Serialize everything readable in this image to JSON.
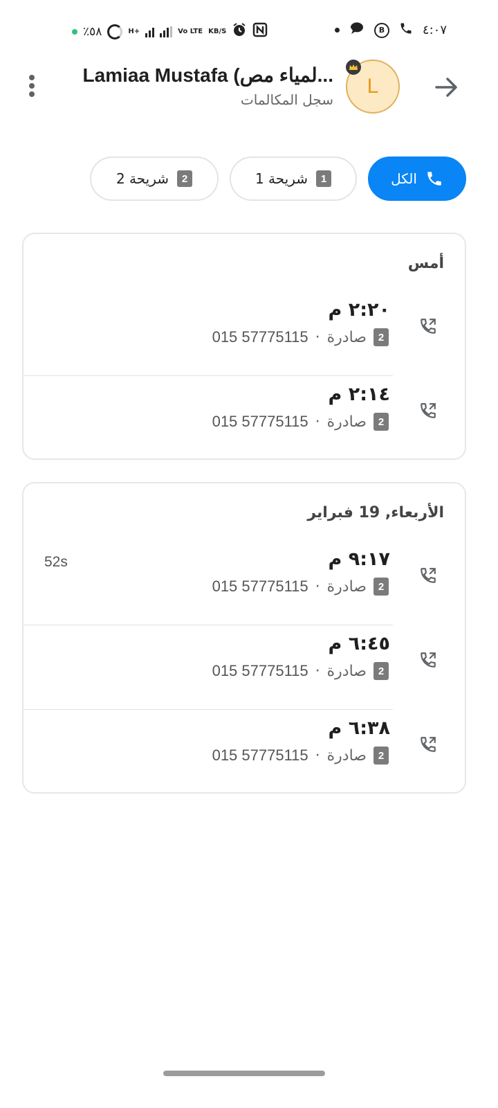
{
  "status_bar": {
    "time": "٤:٠٧",
    "battery": "٪٥٨",
    "net_type": "H+",
    "volte": "Vo LTE",
    "speed_unit": "KB/S",
    "nfc_label": "N",
    "b_badge": "B"
  },
  "header": {
    "contact_name": "Lamiaa Mustafa (لمياء مص...",
    "subtitle": "سجل المكالمات",
    "avatar_letter": "L"
  },
  "filters": [
    {
      "label": "الكل",
      "icon": "phone-icon",
      "active": true
    },
    {
      "label": "شريحة 1",
      "icon": "sim-1",
      "badge": "1"
    },
    {
      "label": "شريحة 2",
      "icon": "sim-2",
      "badge": "2"
    }
  ],
  "groups": [
    {
      "title": "أمس",
      "calls": [
        {
          "time": "٢:٢٠ م",
          "sim": "2",
          "type": "صادرة",
          "number": "015 57775115",
          "duration": ""
        },
        {
          "time": "٢:١٤ م",
          "sim": "2",
          "type": "صادرة",
          "number": "015 57775115",
          "duration": ""
        }
      ]
    },
    {
      "title": "الأربعاء, 19 فبراير",
      "calls": [
        {
          "time": "٩:١٧ م",
          "sim": "2",
          "type": "صادرة",
          "number": "015 57775115",
          "duration": "52s"
        },
        {
          "time": "٦:٤٥ م",
          "sim": "2",
          "type": "صادرة",
          "number": "015 57775115",
          "duration": ""
        },
        {
          "time": "٦:٣٨ م",
          "sim": "2",
          "type": "صادرة",
          "number": "015 57775115",
          "duration": ""
        }
      ]
    }
  ],
  "colors": {
    "accent": "#0a85f5",
    "avatar_bg": "#fde9c4",
    "avatar_text": "#e89a1a"
  }
}
